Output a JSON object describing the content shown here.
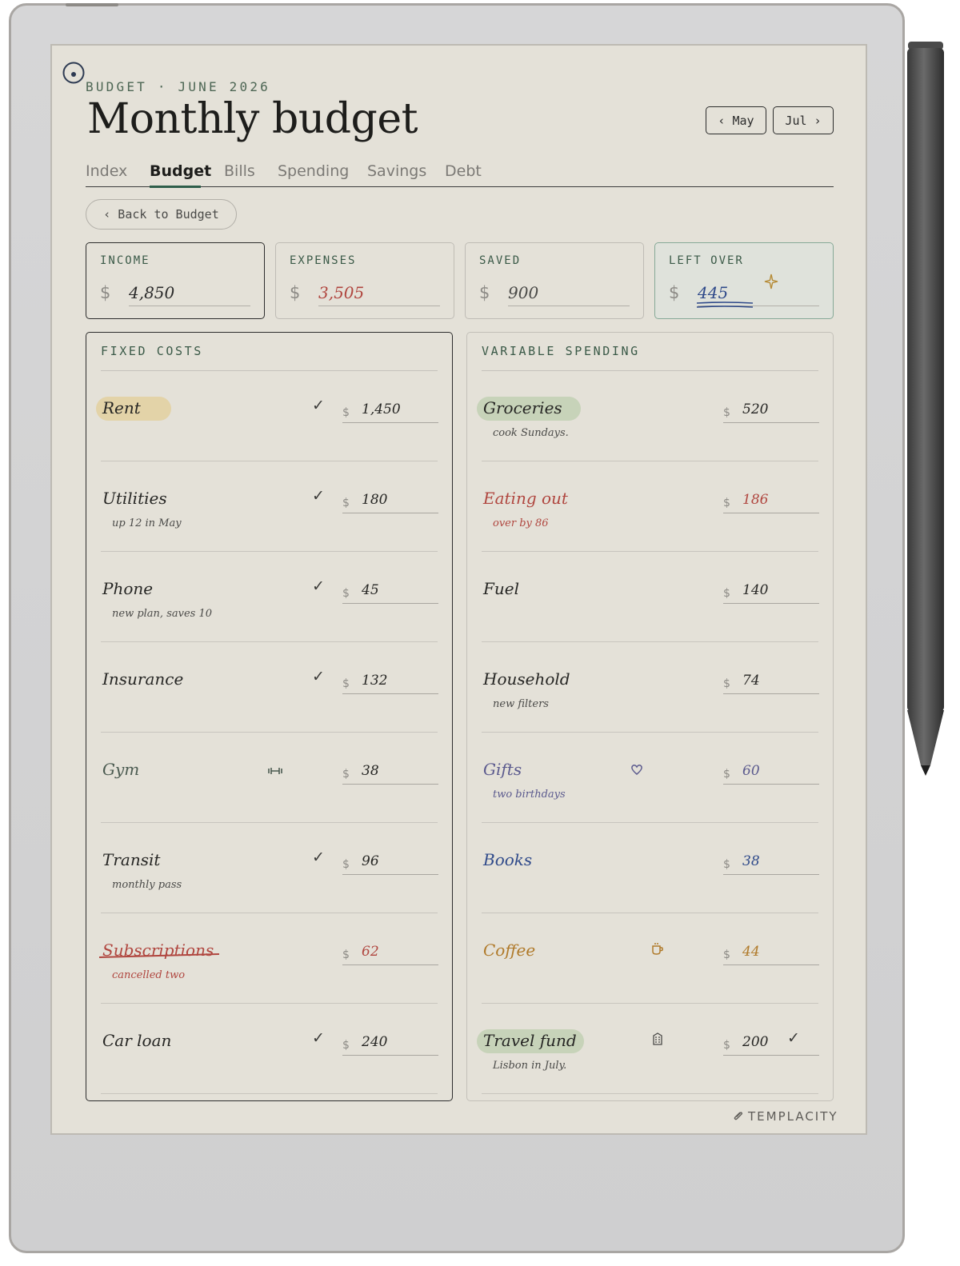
{
  "header": {
    "breadcrumb": "BUDGET · JUNE 2026",
    "title": "Monthly budget",
    "prev_month": "‹ May",
    "next_month": "Jul ›"
  },
  "tabs": [
    {
      "label": "Index",
      "active": false
    },
    {
      "label": "Budget",
      "active": true
    },
    {
      "label": "Bills",
      "active": false
    },
    {
      "label": "Spending",
      "active": false
    },
    {
      "label": "Savings",
      "active": false
    },
    {
      "label": "Debt",
      "active": false
    }
  ],
  "back_button": "‹ Back to Budget",
  "summary": [
    {
      "label": "INCOME",
      "currency": "$",
      "value": "4,850",
      "color": "#2b2b2b"
    },
    {
      "label": "EXPENSES",
      "currency": "$",
      "value": "3,505",
      "color": "#b0463f"
    },
    {
      "label": "SAVED",
      "currency": "$",
      "value": "900",
      "color": "#4a4a48"
    },
    {
      "label": "LEFT OVER",
      "currency": "$",
      "value": "445",
      "color": "#2f4a8a"
    }
  ],
  "fixed_costs": {
    "heading": "FIXED COSTS",
    "rows": [
      {
        "name": "Rent",
        "note": "",
        "currency": "$",
        "amount": "1,450",
        "checked": true,
        "highlight": "#e3d3a8"
      },
      {
        "name": "Utilities",
        "note": "up 12 in May",
        "currency": "$",
        "amount": "180",
        "checked": true
      },
      {
        "name": "Phone",
        "note": "new plan, saves 10",
        "currency": "$",
        "amount": "45",
        "checked": true
      },
      {
        "name": "Insurance",
        "note": "",
        "currency": "$",
        "amount": "132",
        "checked": true
      },
      {
        "name": "Gym",
        "note": "",
        "currency": "$",
        "amount": "38",
        "checked": false,
        "icon": "dumbbell-icon",
        "name_color": "#4a5a50"
      },
      {
        "name": "Transit",
        "note": "monthly pass",
        "currency": "$",
        "amount": "96",
        "checked": true
      },
      {
        "name": "Subscriptions",
        "note": "cancelled two",
        "currency": "$",
        "amount": "62",
        "checked": false,
        "struck": true,
        "name_color": "#b0463f"
      },
      {
        "name": "Car loan",
        "note": "",
        "currency": "$",
        "amount": "240",
        "checked": true
      }
    ]
  },
  "variable_spending": {
    "heading": "VARIABLE SPENDING",
    "rows": [
      {
        "name": "Groceries",
        "note": "cook Sundays.",
        "currency": "$",
        "amount": "520",
        "highlight": "#c7d3b9"
      },
      {
        "name": "Eating out",
        "note": "over by 86",
        "currency": "$",
        "amount": "186",
        "name_color": "#b0463f"
      },
      {
        "name": "Fuel",
        "note": "",
        "currency": "$",
        "amount": "140"
      },
      {
        "name": "Household",
        "note": "new filters",
        "currency": "$",
        "amount": "74"
      },
      {
        "name": "Gifts",
        "note": "two birthdays",
        "currency": "$",
        "amount": "60",
        "icon": "heart-icon",
        "name_color": "#5b5a8e"
      },
      {
        "name": "Books",
        "note": "",
        "currency": "$",
        "amount": "38",
        "name_color": "#2f4a8a"
      },
      {
        "name": "Coffee",
        "note": "",
        "currency": "$",
        "amount": "44",
        "icon": "coffee-cup-icon",
        "name_color": "#b07a2a"
      },
      {
        "name": "Travel fund",
        "note": "Lisbon in July.",
        "currency": "$",
        "amount": "200",
        "icon": "building-icon",
        "highlight": "#c7d3b9",
        "checked_after": true
      }
    ]
  },
  "brand": "TEMPLACITY",
  "colors": {
    "accent_green": "#2e5e4a",
    "red": "#b0463f",
    "blue": "#2f4a8a"
  }
}
